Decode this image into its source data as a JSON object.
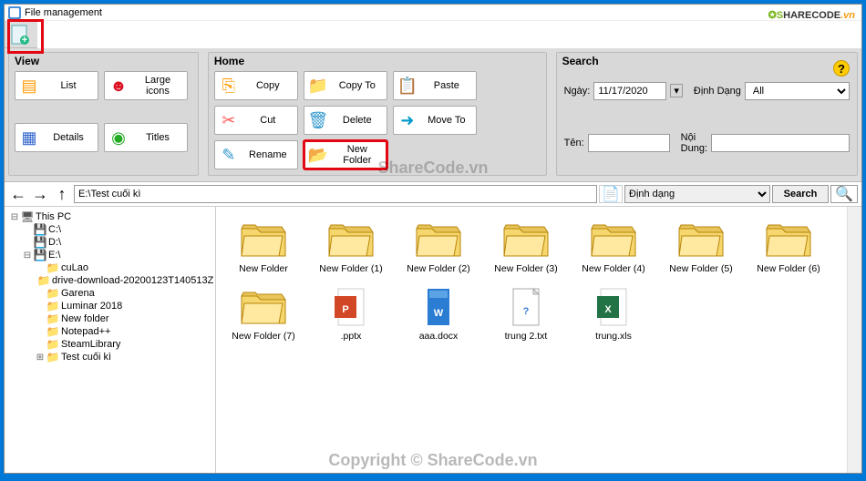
{
  "watermarks": {
    "logo_s": "S",
    "logo_hare": "HARE",
    "logo_code": "CODE",
    "logo_vn": ".vn",
    "center1": "ShareCode.vn",
    "center2": "Copyright © ShareCode.vn"
  },
  "title": "File management",
  "help": "?",
  "ribbon": {
    "view_label": "View",
    "home_label": "Home",
    "search_label": "Search",
    "list": "List",
    "large_icons": "Large icons",
    "details": "Details",
    "titles": "Titles",
    "copy": "Copy",
    "copy_to": "Copy To",
    "paste": "Paste",
    "cut": "Cut",
    "delete": "Delete",
    "move_to": "Move To",
    "rename": "Rename",
    "new_folder": "New Folder",
    "search_date_lbl": "Ngày:",
    "search_date_val": "11/17/2020",
    "search_format_lbl": "Định Dạng",
    "search_format_val": "All",
    "search_name_lbl": "Tên:",
    "search_name_val": "",
    "search_content_lbl": "Nội Dung:",
    "search_content_val": ""
  },
  "address": {
    "path": "E:\\Test cuối kì",
    "type_label": "Định dạng",
    "search_btn": "Search"
  },
  "tree": {
    "root": "This PC",
    "drives": [
      {
        "label": "C:\\",
        "children": []
      },
      {
        "label": "D:\\",
        "children": []
      },
      {
        "label": "E:\\",
        "children": [
          {
            "label": "cuLao"
          },
          {
            "label": "drive-download-20200123T140513Z"
          },
          {
            "label": "Garena"
          },
          {
            "label": "Luminar 2018"
          },
          {
            "label": "New folder"
          },
          {
            "label": "Notepad++"
          },
          {
            "label": "SteamLibrary"
          },
          {
            "label": "Test cuối kì",
            "expandable": true
          }
        ]
      }
    ]
  },
  "files": [
    {
      "name": "New Folder",
      "type": "folder"
    },
    {
      "name": "New Folder (1)",
      "type": "folder"
    },
    {
      "name": "New Folder (2)",
      "type": "folder"
    },
    {
      "name": "New Folder (3)",
      "type": "folder"
    },
    {
      "name": "New Folder (4)",
      "type": "folder"
    },
    {
      "name": "New Folder (5)",
      "type": "folder"
    },
    {
      "name": "New Folder (6)",
      "type": "folder"
    },
    {
      "name": "New Folder (7)",
      "type": "folder"
    },
    {
      "name": ".pptx",
      "type": "pptx"
    },
    {
      "name": "aaa.docx",
      "type": "docx"
    },
    {
      "name": "trung 2.txt",
      "type": "txt"
    },
    {
      "name": "trung.xls",
      "type": "xls"
    }
  ]
}
